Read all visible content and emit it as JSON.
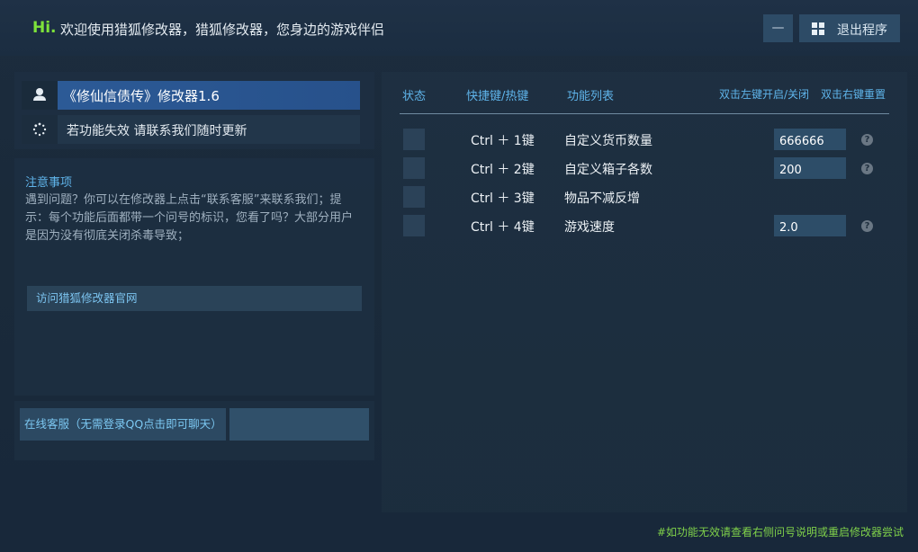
{
  "header": {
    "hi": "Hi.",
    "welcome": "欢迎使用猎狐修改器，猎狐修改器，您身边的游戏伴侣",
    "minimize_label": "—",
    "exit_label": "退出程序"
  },
  "game": {
    "title": "《修仙信债传》修改器1.6",
    "hint": "若功能失效  请联系我们随时更新"
  },
  "notes": {
    "title": "注意事项",
    "body": "遇到问题？你可以在修改器上点击“联系客服”来联系我们；提示：每个功能后面都带一个问号的标识，您看了吗？大部分用户是因为没有彻底关闭杀毒导致；",
    "visit_link": "访问猎狐修改器官网"
  },
  "service": {
    "online_label": "在线客服（无需登录QQ点击即可聊天）"
  },
  "table": {
    "col_status": "状态",
    "col_hotkey": "快捷键/热键",
    "col_function": "功能列表",
    "toggle_hint": "双击左键开启/关闭",
    "reset_hint": "双击右键重置",
    "rows": [
      {
        "hotkey": "Ctrl ＋ 1键",
        "name": "自定义货币数量",
        "value": "666666",
        "help": "?"
      },
      {
        "hotkey": "Ctrl ＋ 2键",
        "name": "自定义箱子各数",
        "value": "200",
        "help": "?"
      },
      {
        "hotkey": "Ctrl ＋ 3键",
        "name": "物品不减反增"
      },
      {
        "hotkey": "Ctrl ＋ 4键",
        "name": "游戏速度",
        "value": "2.0",
        "help": "?"
      }
    ]
  },
  "footer": {
    "note": "#如功能无效请查看右侧问号说明或重启修改器尝试"
  },
  "colors": {
    "accent_green": "#7ee33a",
    "link_blue": "#5fb4ea",
    "title_bar_blue": "#2c5a96",
    "footer_green": "#7fd14a"
  }
}
